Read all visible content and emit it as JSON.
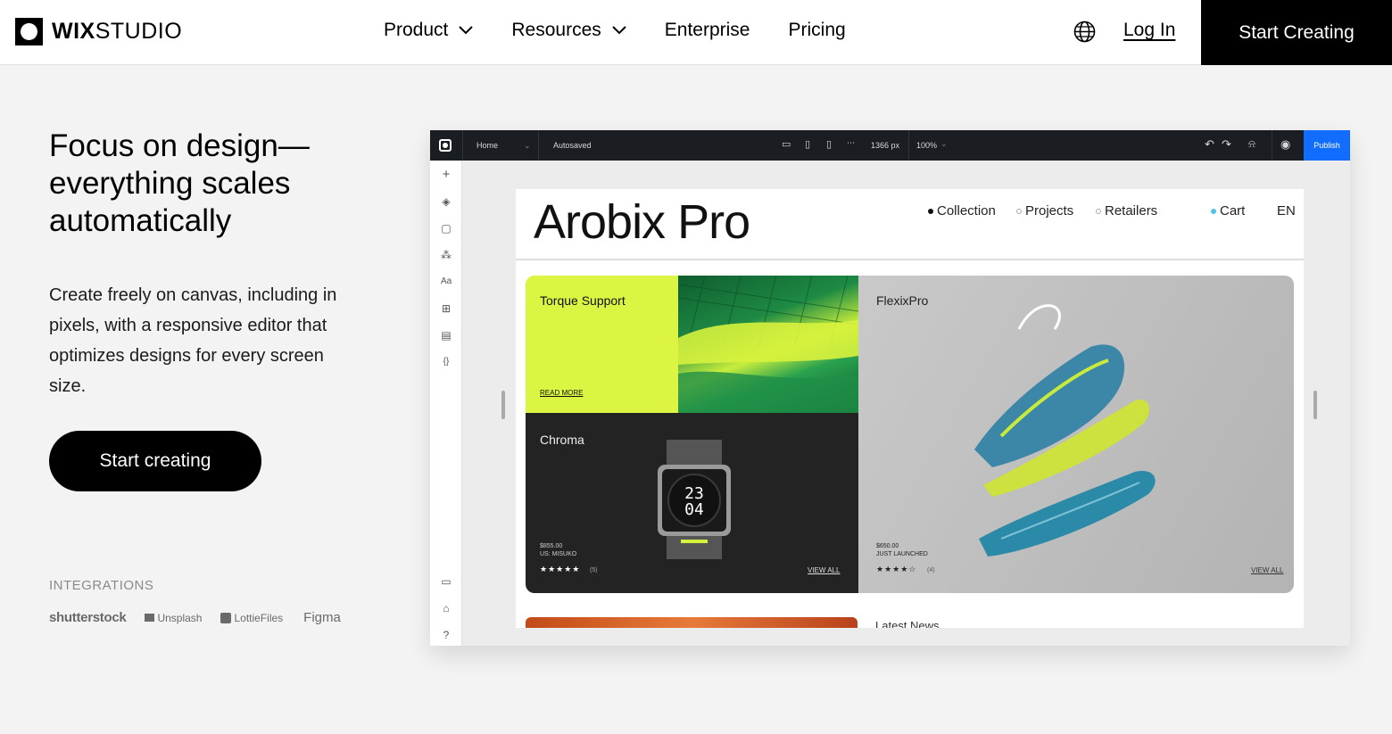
{
  "nav": {
    "logo_bold": "WIX",
    "logo_light": "STUDIO",
    "links": [
      {
        "label": "Product",
        "dropdown": true
      },
      {
        "label": "Resources",
        "dropdown": true
      },
      {
        "label": "Enterprise",
        "dropdown": false
      },
      {
        "label": "Pricing",
        "dropdown": false
      }
    ],
    "globe_icon": "globe-icon",
    "login": "Log In",
    "start": "Start Creating"
  },
  "hero": {
    "headline": "Focus on design—everything scales automatically",
    "description": "Create freely on canvas, including in pixels, with a responsive editor that optimizes designs for every screen size.",
    "cta": "Start creating",
    "integrations_title": "INTEGRATIONS",
    "integrations": [
      "shutterstock",
      "Unsplash",
      "LottieFiles",
      "Figma"
    ]
  },
  "editor": {
    "page": "Home",
    "status": "Autosaved",
    "width": "1366 px",
    "zoom": "100%",
    "publish": "Publish",
    "site": {
      "title": "Arobix Pro",
      "nav": [
        "Collection",
        "Projects",
        "Retailers"
      ],
      "cart": "Cart",
      "lang": "EN",
      "card1_title": "Torque Support",
      "card1_link": "READ MORE",
      "card2_title": "Chroma",
      "card2_price": "$855.00",
      "card2_sub": "US: MISUKO",
      "card2_stars": "★★★★★",
      "card2_count": "(5)",
      "card2_link": "VIEW ALL",
      "watch_time_top": "23",
      "watch_time_bottom": "04",
      "card3_title": "FlexixPro",
      "card3_price": "$650.00",
      "card3_sub": "JUST LAUNCHED",
      "card3_stars": "★★★★☆",
      "card3_count": "(4)",
      "card3_link": "VIEW ALL",
      "latest": "Latest News"
    }
  },
  "colors": {
    "black": "#000000",
    "lime": "#dbf542",
    "publish_blue": "#116dff",
    "editor_bar": "#1a1d21",
    "page_bg": "#f3f3f3"
  }
}
